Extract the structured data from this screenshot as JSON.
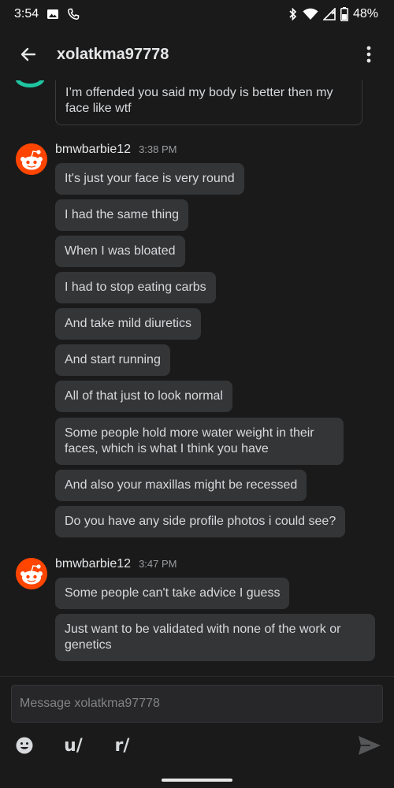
{
  "status_bar": {
    "time": "3:54",
    "battery": "48%"
  },
  "header": {
    "title": "xolatkma97778"
  },
  "previous_message": {
    "text": "I’m offended you said my body is better then my face like wtf"
  },
  "groups": [
    {
      "username": "bmwbarbie12",
      "time": "3:38 PM",
      "messages": [
        "It's just your face is very round",
        "I had the same thing",
        "When I was bloated",
        "I had to stop eating carbs",
        "And take mild diuretics",
        "And start running",
        "All of that just to look normal",
        "Some people hold more water weight in their faces, which is what I think you have",
        "And also your maxillas might be recessed",
        "Do you have any side profile photos i could see?"
      ]
    },
    {
      "username": "bmwbarbie12",
      "time": "3:47 PM",
      "messages": [
        "Some people can't take advice I guess",
        "Just want to be validated with none of the work or genetics"
      ]
    }
  ],
  "composer": {
    "placeholder": "Message xolatkma97778",
    "user_tool": "u/",
    "sub_tool": "r/"
  },
  "colors": {
    "background": "#1a1a1b",
    "bubble": "#343536",
    "avatar": "#ff4500"
  }
}
